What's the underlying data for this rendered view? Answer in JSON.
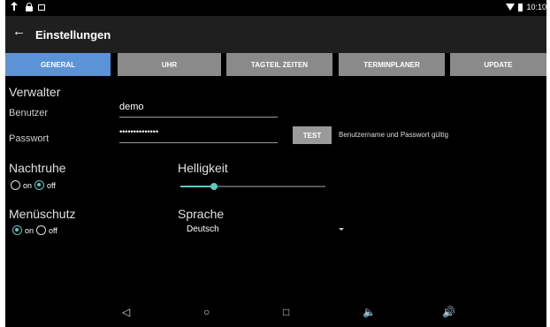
{
  "statusbar": {
    "time": "10:10"
  },
  "appbar": {
    "back_icon": "←",
    "title": "Einstellungen"
  },
  "tabs": [
    {
      "label": "GENERAL",
      "active": true
    },
    {
      "label": "UHR",
      "active": false
    },
    {
      "label": "TAGTEIL ZEITEN",
      "active": false
    },
    {
      "label": "TERMINPLANER",
      "active": false
    },
    {
      "label": "UPDATE",
      "active": false
    }
  ],
  "admin": {
    "heading": "Verwalter",
    "user_label": "Benutzer",
    "user_value": "demo",
    "password_label": "Passwort",
    "password_value": "••••••••••••••",
    "test_label": "TEST",
    "status": "Benutzername und Passwort gültig"
  },
  "night": {
    "heading": "Nachtruhe",
    "on_label": "on",
    "off_label": "off",
    "selected": "off"
  },
  "brightness": {
    "heading": "Helligkeit",
    "level": 0.23
  },
  "menuprotect": {
    "heading": "Menüschutz",
    "on_label": "on",
    "off_label": "off",
    "selected": "on"
  },
  "language": {
    "heading": "Sprache",
    "value": "Deutsch"
  },
  "navbar": {
    "back": "◁",
    "home": "○",
    "recent": "□",
    "vol_down": "🔈",
    "vol_up": "🔊"
  },
  "colors": {
    "accent": "#5ec8c0",
    "tab_active": "#5b93d6",
    "tab_inactive": "#8a8a8a"
  }
}
